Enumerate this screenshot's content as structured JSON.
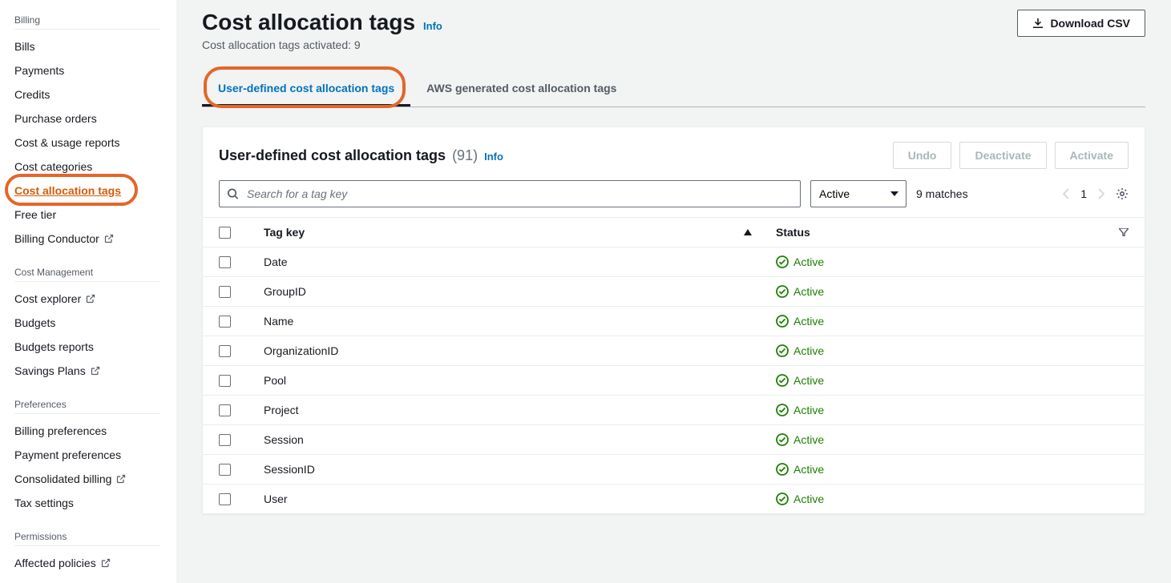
{
  "sidebar": {
    "sections": [
      {
        "title": "Billing",
        "items": [
          {
            "label": "Bills",
            "external": false
          },
          {
            "label": "Payments",
            "external": false
          },
          {
            "label": "Credits",
            "external": false
          },
          {
            "label": "Purchase orders",
            "external": false
          },
          {
            "label": "Cost & usage reports",
            "external": false
          },
          {
            "label": "Cost categories",
            "external": false
          },
          {
            "label": "Cost allocation tags",
            "external": false,
            "active": true
          },
          {
            "label": "Free tier",
            "external": false
          },
          {
            "label": "Billing Conductor",
            "external": true
          }
        ]
      },
      {
        "title": "Cost Management",
        "items": [
          {
            "label": "Cost explorer",
            "external": true
          },
          {
            "label": "Budgets",
            "external": false
          },
          {
            "label": "Budgets reports",
            "external": false
          },
          {
            "label": "Savings Plans",
            "external": true
          }
        ]
      },
      {
        "title": "Preferences",
        "items": [
          {
            "label": "Billing preferences",
            "external": false
          },
          {
            "label": "Payment preferences",
            "external": false
          },
          {
            "label": "Consolidated billing",
            "external": true
          },
          {
            "label": "Tax settings",
            "external": false
          }
        ]
      },
      {
        "title": "Permissions",
        "items": [
          {
            "label": "Affected policies",
            "external": true
          }
        ]
      }
    ]
  },
  "page": {
    "title": "Cost allocation tags",
    "info": "Info",
    "subtitle": "Cost allocation tags activated: 9",
    "download_button": "Download CSV"
  },
  "tabs": [
    {
      "label": "User-defined cost allocation tags",
      "active": true
    },
    {
      "label": "AWS generated cost allocation tags",
      "active": false
    }
  ],
  "panel": {
    "title": "User-defined cost allocation tags",
    "count": "(91)",
    "info": "Info",
    "actions": {
      "undo": "Undo",
      "deactivate": "Deactivate",
      "activate": "Activate"
    },
    "search_placeholder": "Search for a tag key",
    "filter_value": "Active",
    "matches": "9 matches",
    "page": "1"
  },
  "columns": {
    "key": "Tag key",
    "status": "Status"
  },
  "rows": [
    {
      "key": "Date",
      "status": "Active"
    },
    {
      "key": "GroupID",
      "status": "Active"
    },
    {
      "key": "Name",
      "status": "Active"
    },
    {
      "key": "OrganizationID",
      "status": "Active"
    },
    {
      "key": "Pool",
      "status": "Active"
    },
    {
      "key": "Project",
      "status": "Active"
    },
    {
      "key": "Session",
      "status": "Active"
    },
    {
      "key": "SessionID",
      "status": "Active"
    },
    {
      "key": "User",
      "status": "Active"
    }
  ]
}
